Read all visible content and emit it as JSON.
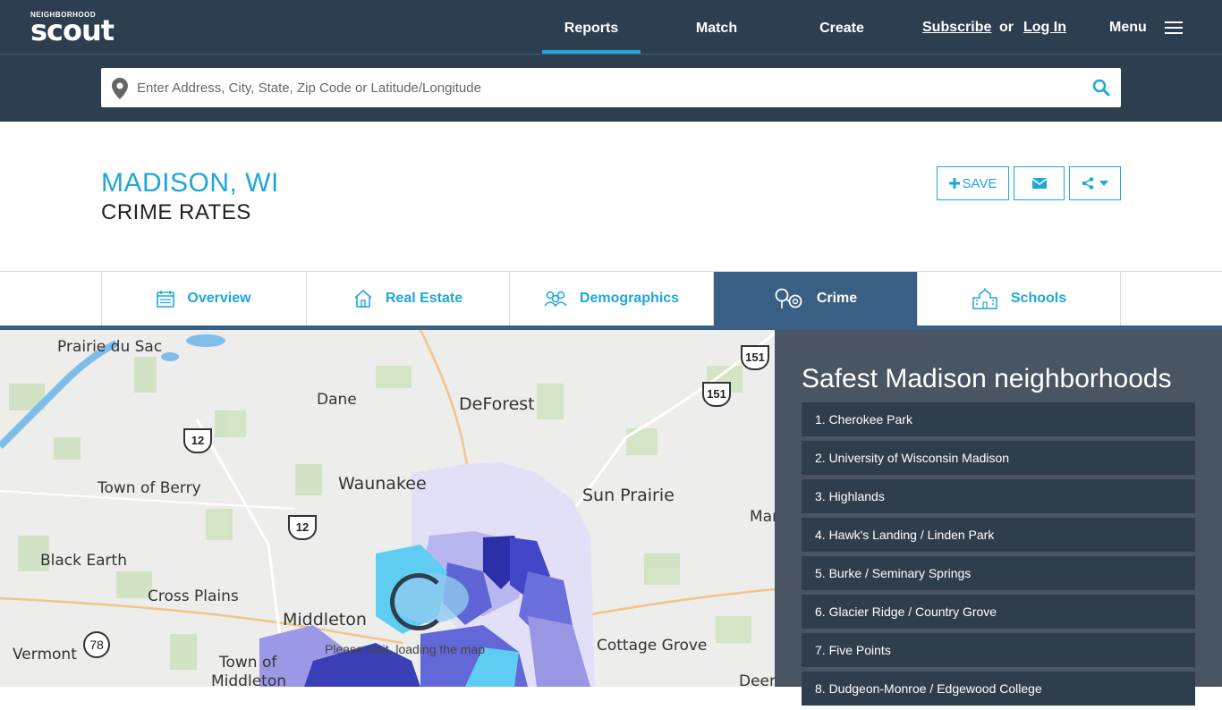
{
  "header": {
    "logo_small": "NEIGHBORHOOD",
    "logo_big": "scout",
    "nav": [
      {
        "label": "Reports",
        "active": true
      },
      {
        "label": "Match",
        "active": false
      },
      {
        "label": "Create",
        "active": false
      }
    ],
    "subscribe": "Subscribe",
    "or": "or",
    "login": "Log In",
    "menu": "Menu"
  },
  "search": {
    "placeholder": "Enter Address, City, State, Zip Code or Latitude/Longitude",
    "value": ""
  },
  "page": {
    "city": "MADISON, WI",
    "subtitle": "CRIME RATES",
    "save_label": "SAVE"
  },
  "tabs": [
    {
      "label": "Overview",
      "icon": "calendar-icon",
      "active": false
    },
    {
      "label": "Real Estate",
      "icon": "house-icon",
      "active": false
    },
    {
      "label": "Demographics",
      "icon": "people-icon",
      "active": false
    },
    {
      "label": "Crime",
      "icon": "handcuffs-icon",
      "active": true
    },
    {
      "label": "Schools",
      "icon": "school-building-icon",
      "active": false
    }
  ],
  "map": {
    "labels": [
      "Prairie du Sac",
      "Dane",
      "DeForest",
      "Waunakee",
      "Sun Prairie",
      "Town of Berry",
      "Black Earth",
      "Cross Plains",
      "Middleton",
      "Vermont",
      "Town of",
      "Middleton",
      "Cottage Grove",
      "Deer",
      "Mar"
    ],
    "shields": [
      "151",
      "151",
      "12",
      "12",
      "78"
    ],
    "loading": "Please wait, loading the map"
  },
  "panel": {
    "title": "Safest Madison neighborhoods",
    "items": [
      "1. Cherokee Park",
      "2. University of Wisconsin Madison",
      "3. Highlands",
      "4. Hawk's Landing / Linden Park",
      "5. Burke / Seminary Springs",
      "6. Glacier Ridge / Country Grove",
      "7. Five Points",
      "8. Dudgeon-Monroe / Edgewood College"
    ]
  },
  "colors": {
    "navy": "#2c3e50",
    "accent": "#1ea7d8",
    "tab_active": "#3a5f85",
    "panel_bg": "#4a5563",
    "panel_item": "#2f3e4d"
  }
}
